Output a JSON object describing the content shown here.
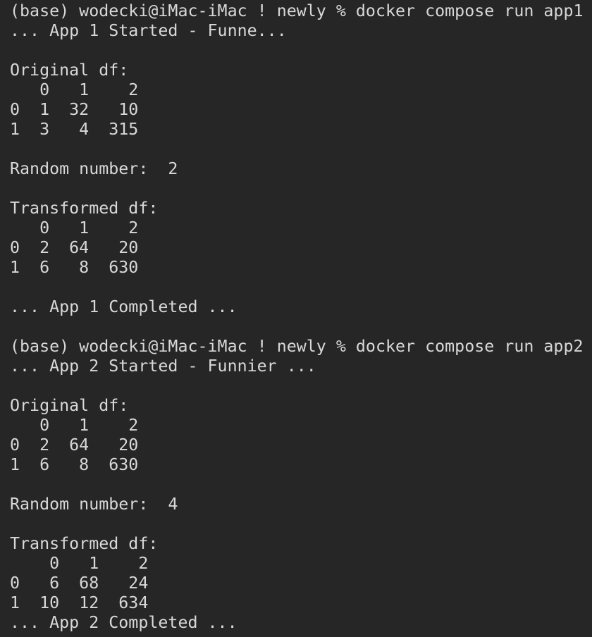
{
  "terminal": {
    "lines": [
      "(base) wodecki@iMac-iMac ! newly % docker compose run app1",
      "... App 1 Started - Funne...",
      "",
      "Original df:",
      "   0   1    2",
      "0  1  32   10",
      "1  3   4  315",
      "",
      "Random number:  2",
      "",
      "Transformed df:",
      "   0   1    2",
      "0  2  64   20",
      "1  6   8  630",
      "",
      "... App 1 Completed ...",
      "",
      "(base) wodecki@iMac-iMac ! newly % docker compose run app2",
      "... App 2 Started - Funnier ...",
      "",
      "Original df:",
      "   0   1    2",
      "0  2  64   20",
      "1  6   8  630",
      "",
      "Random number:  4",
      "",
      "Transformed df:",
      "    0   1    2",
      "0   6  68   24",
      "1  10  12  634",
      "... App 2 Completed ..."
    ]
  }
}
